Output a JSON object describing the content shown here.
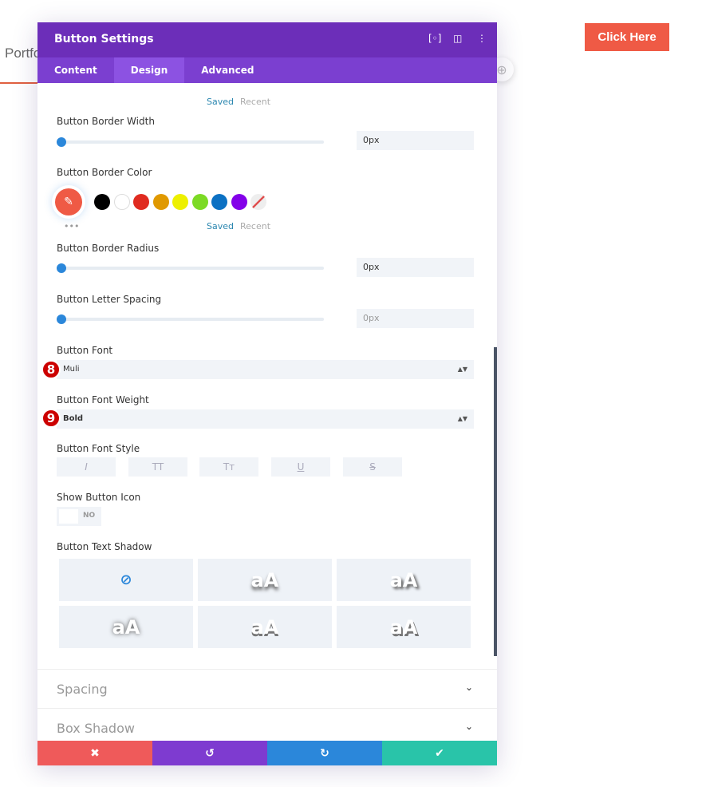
{
  "background": {
    "text": "Portfo",
    "cta": "Click Here"
  },
  "panel": {
    "title": "Button Settings",
    "tabs": [
      "Content",
      "Design",
      "Advanced"
    ],
    "active_tab": "Design"
  },
  "palette": {
    "saved": "Saved",
    "recent": "Recent",
    "more": "•••",
    "colors": [
      "#000000",
      "#ffffff",
      "#e02b20",
      "#e09900",
      "#edf000",
      "#7cda24",
      "#0c71c3",
      "#8300e9"
    ],
    "current": "#ef5a45"
  },
  "fields": {
    "border_width": {
      "label": "Button Border Width",
      "value": "0px"
    },
    "border_color": {
      "label": "Button Border Color"
    },
    "border_radius": {
      "label": "Button Border Radius",
      "value": "0px"
    },
    "letter_spacing": {
      "label": "Button Letter Spacing",
      "value": "0px"
    },
    "font": {
      "label": "Button Font",
      "value": "Muli",
      "badge": "8"
    },
    "font_weight": {
      "label": "Button Font Weight",
      "value": "Bold",
      "badge": "9"
    },
    "font_style": {
      "label": "Button Font Style",
      "options": [
        "I",
        "TT",
        "Tт",
        "U",
        "S"
      ]
    },
    "show_icon": {
      "label": "Show Button Icon",
      "value": "NO"
    },
    "text_shadow": {
      "label": "Button Text Shadow",
      "sample": "aA"
    }
  },
  "sections": [
    "Spacing",
    "Box Shadow"
  ],
  "footer": {
    "colors": [
      "#ef5a5a",
      "#7e3bd0",
      "#2b87da",
      "#29c4a9"
    ]
  }
}
